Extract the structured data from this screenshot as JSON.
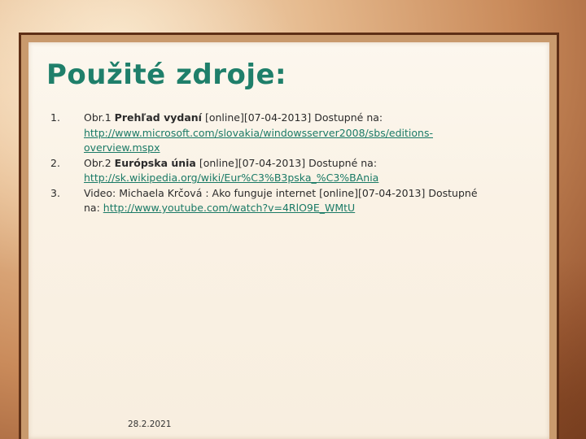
{
  "slide": {
    "title": "Použité zdroje:",
    "sources": [
      {
        "number": "1.",
        "prefix": "Obr.1 ",
        "name": "Prehľad vydaní",
        "details": " [online][07-04-2013] Dostupné na:",
        "url": "http://www.microsoft.com/slovakia/windowsserver2008/sbs/editions-overview.mspx"
      },
      {
        "number": "2.",
        "prefix": "Obr.2 ",
        "name": "Európska únia",
        "details": " [online][07-04-2013] Dostupné na:",
        "url": "http://sk.wikipedia.org/wiki/Eur%C3%B3pska_%C3%BAnia"
      },
      {
        "number": "3.",
        "text": "Video: Michaela Krčová : Ako funguje internet [online][07-04-2013] Dostupné na: ",
        "url": "http://www.youtube.com/watch?v=4RlO9E_WMtU"
      }
    ],
    "date": "28.2.2021"
  },
  "colors": {
    "title": "#1f7f6a",
    "frame": "#5e2f16",
    "link": "#1a7a66"
  }
}
